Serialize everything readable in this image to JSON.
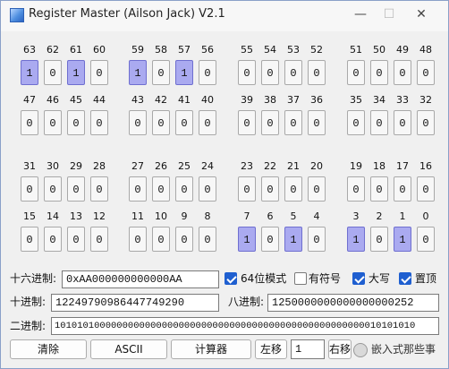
{
  "window": {
    "title": "Register Master (Ailson Jack) V2.1",
    "min_glyph": "—",
    "max_glyph": "☐",
    "close_glyph": "✕"
  },
  "bit_rows": [
    {
      "bits": [
        {
          "index": "63",
          "value": "1"
        },
        {
          "index": "62",
          "value": "0"
        },
        {
          "index": "61",
          "value": "1"
        },
        {
          "index": "60",
          "value": "0"
        },
        {
          "index": "59",
          "value": "1"
        },
        {
          "index": "58",
          "value": "0"
        },
        {
          "index": "57",
          "value": "1"
        },
        {
          "index": "56",
          "value": "0"
        },
        {
          "index": "55",
          "value": "0"
        },
        {
          "index": "54",
          "value": "0"
        },
        {
          "index": "53",
          "value": "0"
        },
        {
          "index": "52",
          "value": "0"
        },
        {
          "index": "51",
          "value": "0"
        },
        {
          "index": "50",
          "value": "0"
        },
        {
          "index": "49",
          "value": "0"
        },
        {
          "index": "48",
          "value": "0"
        }
      ]
    },
    {
      "bits": [
        {
          "index": "47",
          "value": "0"
        },
        {
          "index": "46",
          "value": "0"
        },
        {
          "index": "45",
          "value": "0"
        },
        {
          "index": "44",
          "value": "0"
        },
        {
          "index": "43",
          "value": "0"
        },
        {
          "index": "42",
          "value": "0"
        },
        {
          "index": "41",
          "value": "0"
        },
        {
          "index": "40",
          "value": "0"
        },
        {
          "index": "39",
          "value": "0"
        },
        {
          "index": "38",
          "value": "0"
        },
        {
          "index": "37",
          "value": "0"
        },
        {
          "index": "36",
          "value": "0"
        },
        {
          "index": "35",
          "value": "0"
        },
        {
          "index": "34",
          "value": "0"
        },
        {
          "index": "33",
          "value": "0"
        },
        {
          "index": "32",
          "value": "0"
        }
      ]
    },
    {
      "bits": [
        {
          "index": "31",
          "value": "0"
        },
        {
          "index": "30",
          "value": "0"
        },
        {
          "index": "29",
          "value": "0"
        },
        {
          "index": "28",
          "value": "0"
        },
        {
          "index": "27",
          "value": "0"
        },
        {
          "index": "26",
          "value": "0"
        },
        {
          "index": "25",
          "value": "0"
        },
        {
          "index": "24",
          "value": "0"
        },
        {
          "index": "23",
          "value": "0"
        },
        {
          "index": "22",
          "value": "0"
        },
        {
          "index": "21",
          "value": "0"
        },
        {
          "index": "20",
          "value": "0"
        },
        {
          "index": "19",
          "value": "0"
        },
        {
          "index": "18",
          "value": "0"
        },
        {
          "index": "17",
          "value": "0"
        },
        {
          "index": "16",
          "value": "0"
        }
      ]
    },
    {
      "bits": [
        {
          "index": "15",
          "value": "0"
        },
        {
          "index": "14",
          "value": "0"
        },
        {
          "index": "13",
          "value": "0"
        },
        {
          "index": "12",
          "value": "0"
        },
        {
          "index": "11",
          "value": "0"
        },
        {
          "index": "10",
          "value": "0"
        },
        {
          "index": "9",
          "value": "0"
        },
        {
          "index": "8",
          "value": "0"
        },
        {
          "index": "7",
          "value": "1"
        },
        {
          "index": "6",
          "value": "0"
        },
        {
          "index": "5",
          "value": "1"
        },
        {
          "index": "4",
          "value": "0"
        },
        {
          "index": "3",
          "value": "1"
        },
        {
          "index": "2",
          "value": "0"
        },
        {
          "index": "1",
          "value": "1"
        },
        {
          "index": "0",
          "value": "0"
        }
      ]
    }
  ],
  "hex": {
    "label": "十六进制:",
    "value": "0xAA000000000000AA"
  },
  "options": {
    "mode64_label": "64位模式",
    "mode64_checked": true,
    "signed_label": "有符号",
    "signed_checked": false,
    "upper_label": "大写",
    "upper_checked": true,
    "top_label": "置顶",
    "top_checked": true
  },
  "dec": {
    "label": "十进制:",
    "value": "12249790986447749290"
  },
  "oct": {
    "label": "八进制:",
    "value": "1250000000000000000252"
  },
  "bin": {
    "label": "二进制:",
    "value": "1010101000000000000000000000000000000000000000000000000010101010"
  },
  "buttons": {
    "clear": "清除",
    "ascii": "ASCII",
    "calculator": "计算器",
    "shift_left": "左移",
    "shift_amount": "1",
    "shift_right": "右移"
  },
  "watermark": "嵌入式那些事",
  "colors": {
    "bit_on": "#aaaaf0",
    "bit_off": "#f7f7f7",
    "checkbox_checked": "#1f5fd0"
  }
}
